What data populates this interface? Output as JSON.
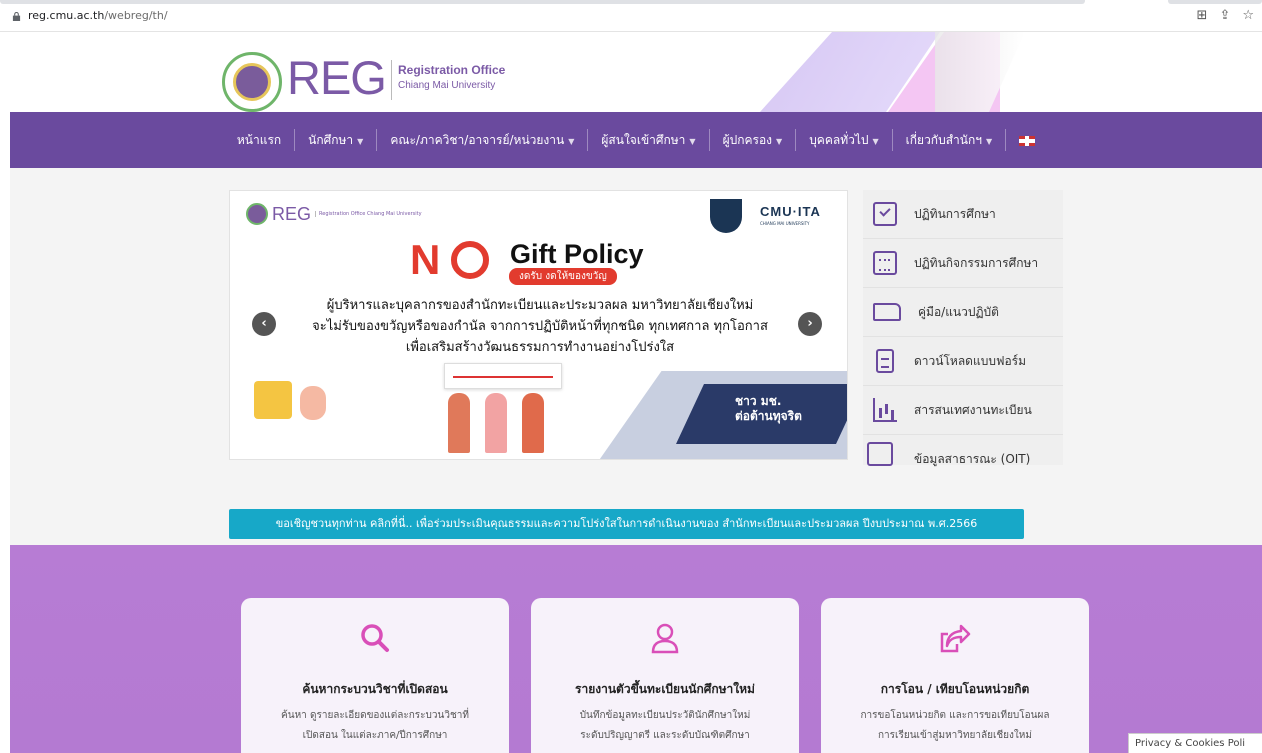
{
  "browser": {
    "url_host": "reg.cmu.ac.th",
    "url_path": "/webreg/th/"
  },
  "header": {
    "logo_text": "REG",
    "logo_sub1": "Registration Office",
    "logo_sub2": "Chiang Mai University"
  },
  "nav": {
    "items": [
      {
        "label": "หน้าแรก",
        "dropdown": false
      },
      {
        "label": "นักศึกษา",
        "dropdown": true
      },
      {
        "label": "คณะ/ภาควิชา/อาจารย์/หน่วยงาน",
        "dropdown": true
      },
      {
        "label": "ผู้สนใจเข้าศึกษา",
        "dropdown": true
      },
      {
        "label": "ผู้ปกครอง",
        "dropdown": true
      },
      {
        "label": "บุคคลทั่วไป",
        "dropdown": true
      },
      {
        "label": "เกี่ยวกับสำนักฯ",
        "dropdown": true
      }
    ],
    "lang_flag": "uk-flag-icon"
  },
  "carousel": {
    "mini_logo": "REG",
    "mini_logo_sub": "Registration Office Chiang Mai University",
    "ita_title": "CMU·ITA",
    "ita_sub": "CHIANG MAI UNIVERSITY",
    "no_text": "N",
    "gift_title": "Gift Policy",
    "gift_sub": "งดรับ งดให้ของขวัญ",
    "message_line1": "ผู้บริหารและบุคลากรของสำนักทะเบียนและประมวลผล มหาวิทยาลัยเชียงใหม่",
    "message_line2": "จะไม่รับของขวัญหรือของกำนัล จากการปฏิบัติหน้าที่ทุกชนิด ทุกเทศกาล ทุกโอกาส",
    "message_line3": "เพื่อเสริมสร้างวัฒนธรรมการทำงานอย่างโปร่งใส",
    "sign_line1": "ชาว มช.",
    "sign_line2": "ต่อต้านทุจริต",
    "prev_label": "‹",
    "next_label": "›"
  },
  "quicklinks": [
    {
      "label": "ปฏิทินการศึกษา",
      "icon": "calendar-check-icon"
    },
    {
      "label": "ปฏิทินกิจกรรมการศึกษา",
      "icon": "calendar-icon"
    },
    {
      "label": "คู่มือ/แนวปฏิบัติ",
      "icon": "folder-icon"
    },
    {
      "label": "ดาวน์โหลดแบบฟอร์ม",
      "icon": "document-icon"
    },
    {
      "label": "สารสนเทศงานทะเบียน",
      "icon": "bar-chart-icon"
    },
    {
      "label": "ข้อมูลสาธารณะ (OIT)",
      "icon": "windows-icon"
    }
  ],
  "infobar": {
    "text": "ขอเชิญชวนทุกท่าน คลิกที่นี่.. เพื่อร่วมประเมินคุณธรรมและความโปร่งใสในการดำเนินงานของ สำนักทะเบียนและประมวลผล ปีงบประมาณ พ.ศ.2566"
  },
  "cards": [
    {
      "title": "ค้นหากระบวนวิชาที่เปิดสอน",
      "desc_line1": "ค้นหา ดูรายละเอียดของแต่ละกระบวนวิชาที่",
      "desc_line2": "เปิดสอน ในแต่ละภาค/ปีการศึกษา",
      "icon": "search-icon"
    },
    {
      "title": "รายงานตัวขึ้นทะเบียนนักศึกษาใหม่",
      "desc_line1": "บันทึกข้อมูลทะเบียนประวัตินักศึกษาใหม่",
      "desc_line2": "ระดับปริญญาตรี และระดับบัณฑิตศึกษา",
      "icon": "user-icon"
    },
    {
      "title": "การโอน / เทียบโอนหน่วยกิต",
      "desc_line1": "การขอโอนหน่วยกิต และการขอเทียบโอนผล",
      "desc_line2": "การเรียนเข้าสู่มหาวิทยาลัยเชียงใหม่",
      "icon": "share-icon"
    }
  ],
  "privacy": {
    "label": "Privacy & Cookies Poli"
  },
  "colors": {
    "brand_purple": "#6a4a9e",
    "info_cyan": "#17a8c8",
    "section_purple": "#b77cd4",
    "accent_pink": "#d94fb8"
  }
}
